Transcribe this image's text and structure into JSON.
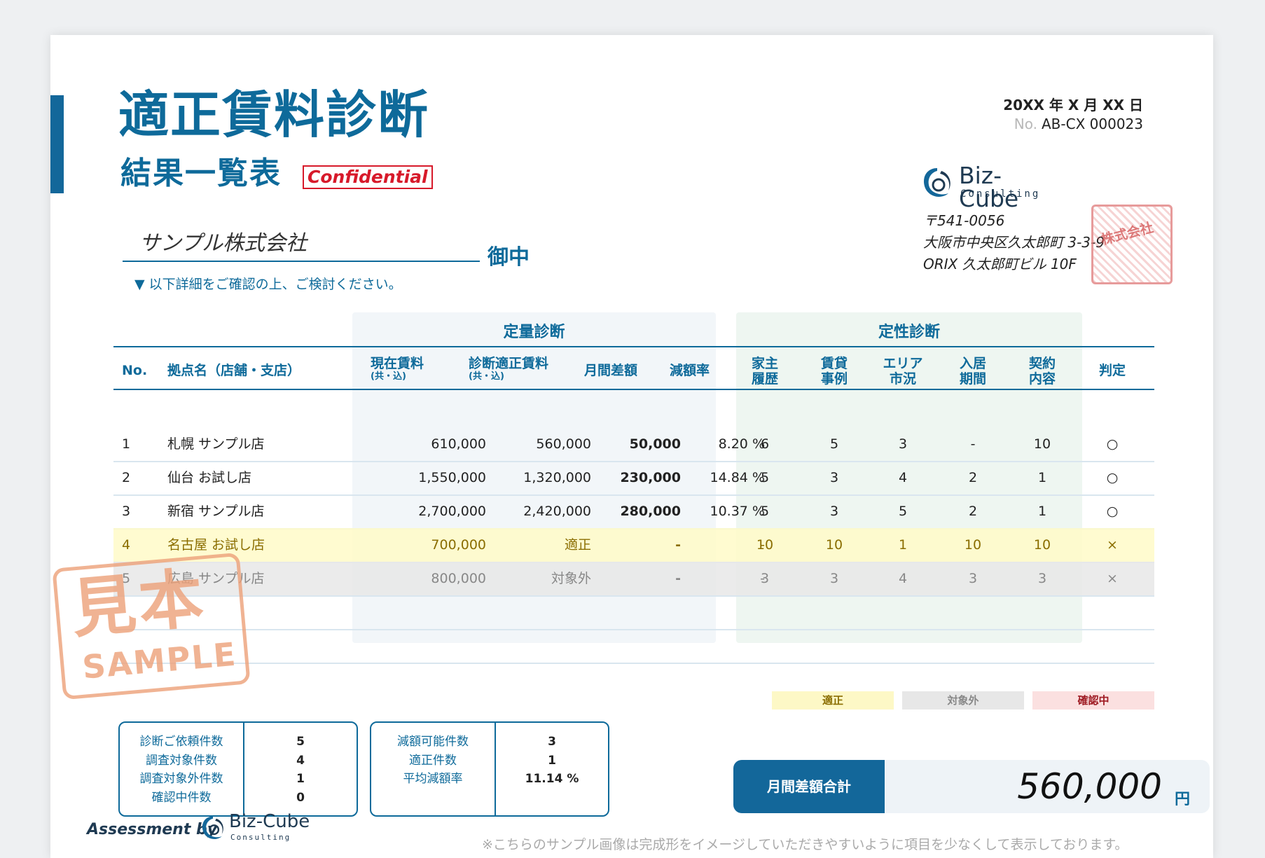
{
  "header": {
    "title": "適正賃料診断",
    "subtitle": "結果一覧表",
    "confidential": "Confidential",
    "date": "20XX 年 X 月 XX 日",
    "doc_no_label": "No.",
    "doc_no": "AB-CX 000023"
  },
  "issuer": {
    "logo_name": "Biz-Cube",
    "logo_tagline": "Consulting",
    "postal": "〒541-0056",
    "address1": "大阪市中央区久太郎町 3-3-9",
    "address2": "ORIX 久太郎町ビル 10F"
  },
  "client": {
    "name": "サンプル株式会社",
    "honorific": "御中",
    "note": "▼ 以下詳細をご確認の上、ご検討ください。"
  },
  "table": {
    "group_quantitative": "定量診断",
    "group_qualitative": "定性診断",
    "headers": {
      "no": "No.",
      "site": "拠点名（店舗・支店）",
      "current_rent": "現在賃料",
      "current_rent_note": "(共・込)",
      "appropriate_rent": "診断適正賃料",
      "appropriate_rent_note": "(共・込)",
      "monthly_diff": "月間差額",
      "reduction_rate": "減額率",
      "landlord_1": "家主",
      "landlord_2": "履歴",
      "lease_1": "賃貸",
      "lease_2": "事例",
      "area_1": "エリア",
      "area_2": "市況",
      "tenancy_1": "入居",
      "tenancy_2": "期間",
      "contract_1": "契約",
      "contract_2": "内容",
      "judgement": "判定"
    },
    "rows": [
      {
        "no": "1",
        "site": "札幌 サンプル店",
        "current": "610,000",
        "appropriate": "560,000",
        "diff": "50,000",
        "rate": "8.20 %",
        "landlord": "6",
        "lease": "5",
        "area": "3",
        "tenancy": "-",
        "contract": "10",
        "judge": "○"
      },
      {
        "no": "2",
        "site": "仙台 お試し店",
        "current": "1,550,000",
        "appropriate": "1,320,000",
        "diff": "230,000",
        "rate": "14.84 %",
        "landlord": "5",
        "lease": "3",
        "area": "4",
        "tenancy": "2",
        "contract": "1",
        "judge": "○"
      },
      {
        "no": "3",
        "site": "新宿 サンプル店",
        "current": "2,700,000",
        "appropriate": "2,420,000",
        "diff": "280,000",
        "rate": "10.37 %",
        "landlord": "5",
        "lease": "3",
        "area": "5",
        "tenancy": "2",
        "contract": "1",
        "judge": "○"
      },
      {
        "no": "4",
        "site": "名古屋 お試し店",
        "current": "700,000",
        "appropriate": "適正",
        "diff": "-",
        "rate": "-",
        "landlord": "10",
        "lease": "10",
        "area": "1",
        "tenancy": "10",
        "contract": "10",
        "judge": "×"
      },
      {
        "no": "5",
        "site": "広島 サンプル店",
        "current": "800,000",
        "appropriate": "対象外",
        "diff": "-",
        "rate": "-",
        "landlord": "3",
        "lease": "3",
        "area": "4",
        "tenancy": "3",
        "contract": "3",
        "judge": "×"
      }
    ]
  },
  "legend": {
    "appropriate": "適正",
    "excluded": "対象外",
    "checking": "確認中",
    "colors": {
      "appropriate": "#fdf8c6",
      "excluded": "#e7e7e7",
      "checking": "#fbe0e0"
    }
  },
  "stamp": {
    "kanji": "見本",
    "latin": "SAMPLE"
  },
  "stats1": {
    "labels": [
      "診断ご依頼件数",
      "調査対象件数",
      "調査対象外件数",
      "確認中件数"
    ],
    "values": [
      "5",
      "4",
      "1",
      "0"
    ]
  },
  "stats2": {
    "labels": [
      "減額可能件数",
      "適正件数",
      "平均減額率"
    ],
    "values": [
      "3",
      "1",
      "11.14 %"
    ]
  },
  "total": {
    "label": "月間差額合計",
    "value": "560,000",
    "unit": "円"
  },
  "footer": {
    "assessment_by": "Assessment by",
    "logo_name": "Biz-Cube",
    "logo_tagline": "Consulting",
    "note": "※こちらのサンプル画像は完成形をイメージしていただきやすいように項目を少なくして表示しております。"
  },
  "colors": {
    "primary": "#0e6a9a",
    "accent_red": "#d7192a"
  }
}
